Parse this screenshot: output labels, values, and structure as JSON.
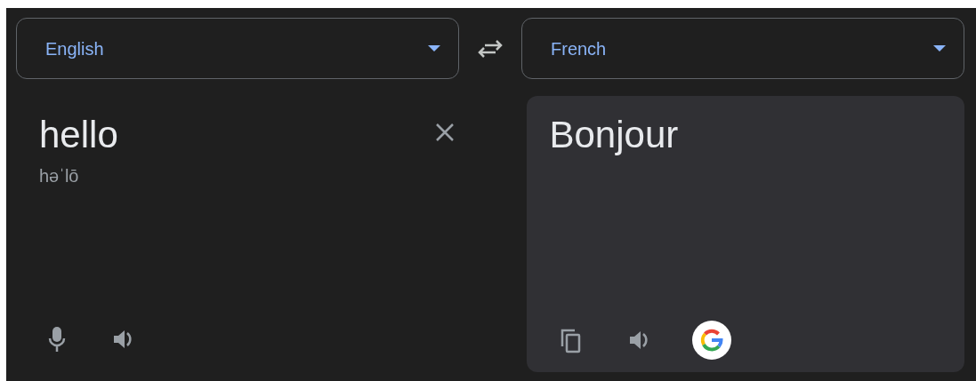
{
  "source_language": {
    "label": "English"
  },
  "target_language": {
    "label": "French"
  },
  "source": {
    "text": "hello",
    "phonetic": "həˈlō"
  },
  "translation": {
    "text": "Bonjour"
  }
}
